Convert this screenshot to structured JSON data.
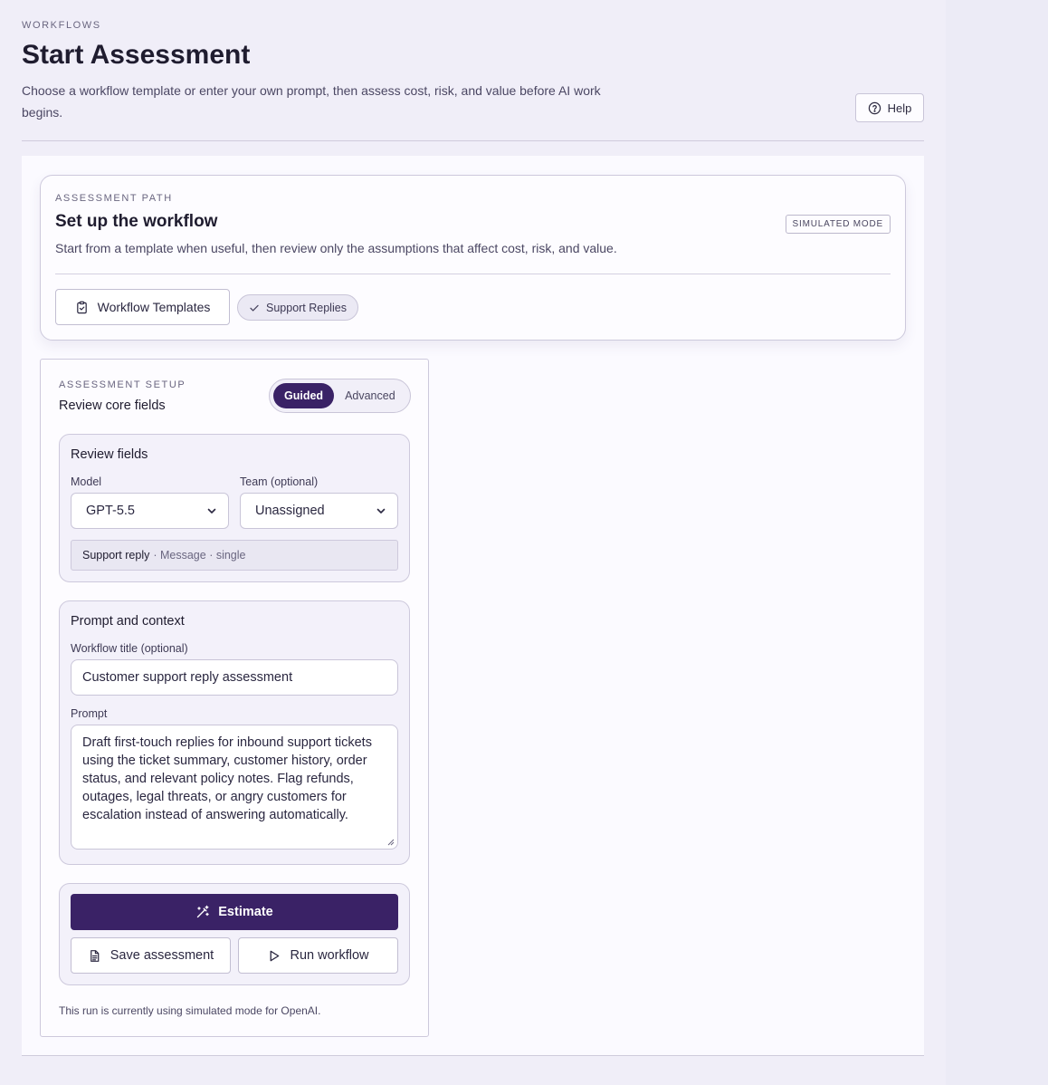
{
  "header": {
    "eyebrow": "WORKFLOWS",
    "title": "Start Assessment",
    "description": "Choose a workflow template or enter your own prompt, then assess cost, risk, and value before AI work begins.",
    "help_label": "Help"
  },
  "path_card": {
    "eyebrow": "ASSESSMENT PATH",
    "title": "Set up the workflow",
    "badge": "SIMULATED MODE",
    "description": "Start from a template when useful, then review only the assumptions that affect cost, risk, and value.",
    "templates_label": "Workflow Templates",
    "selected_template": "Support Replies"
  },
  "setup": {
    "eyebrow": "ASSESSMENT SETUP",
    "title": "Review core fields",
    "modes": [
      "Guided",
      "Advanced"
    ],
    "active_mode": "Guided",
    "review": {
      "title": "Review fields",
      "model_label": "Model",
      "model_value": "GPT-5.5",
      "team_label": "Team (optional)",
      "team_value": "Unassigned",
      "summary_type": "Support reply",
      "summary_meta": "· Message · single"
    },
    "prompt": {
      "title": "Prompt and context",
      "workflow_title_label": "Workflow title (optional)",
      "workflow_title_value": "Customer support reply assessment",
      "prompt_label": "Prompt",
      "prompt_value": "Draft first-touch replies for inbound support tickets using the ticket summary, customer history, order status, and relevant policy notes. Flag refunds, outages, legal threats, or angry customers for escalation instead of answering automatically."
    },
    "actions": {
      "estimate_label": "Estimate",
      "save_label": "Save assessment",
      "run_label": "Run workflow"
    },
    "footnote": "This run is currently using simulated mode for OpenAI."
  },
  "colors": {
    "accent": "#3a2266",
    "background": "#f0eef8",
    "panel": "#fbfaff"
  },
  "icons": [
    "help-circle-icon",
    "clipboard-icon",
    "check-icon",
    "chevron-down-icon",
    "magic-wand-icon",
    "document-icon",
    "play-icon"
  ]
}
